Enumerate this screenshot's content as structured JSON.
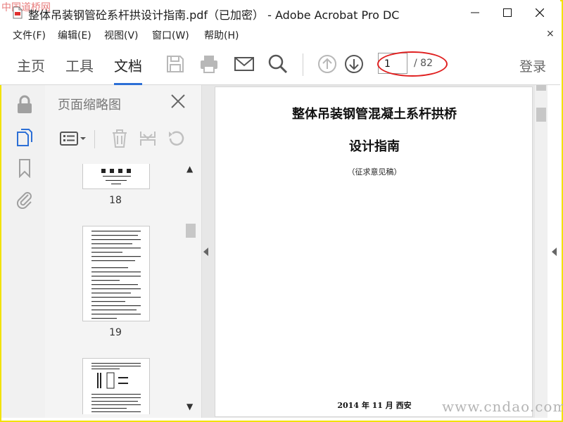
{
  "window": {
    "title": "整体吊装钢管砼系杆拱设计指南.pdf（已加密） - Adobe Acrobat Pro DC",
    "watermark_top": "中国道桥网",
    "watermark_bottom": "www.cndao.com"
  },
  "menu": {
    "items": [
      "文件(F)",
      "编辑(E)",
      "视图(V)",
      "窗口(W)",
      "帮助(H)"
    ],
    "close": "×"
  },
  "toolbar": {
    "tabs": [
      "主页",
      "工具",
      "文档"
    ],
    "active_tab": "文档",
    "page_current": "1",
    "page_total": "/ 82",
    "login": "登录"
  },
  "thumbnails": {
    "title": "页面缩略图",
    "pages": [
      "18",
      "19"
    ]
  },
  "document": {
    "title_line1": "整体吊装钢管混凝土系杆拱桥",
    "title_line2": "设计指南",
    "subtitle": "（征求意见稿）",
    "date": "2014 年 11 月  西安"
  },
  "colors": {
    "frame": "#f2e200",
    "accent": "#2c6fd6",
    "annotation": "#e02020"
  }
}
